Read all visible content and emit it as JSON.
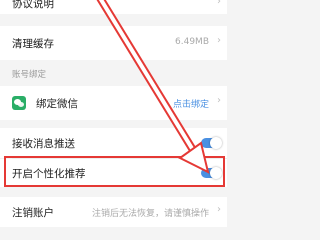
{
  "settings": {
    "agreement_label": "协议说明",
    "clear_cache_label": "清理缓存",
    "cache_size": "6.49MB",
    "account_binding_header": "账号绑定",
    "bind_wechat_label": "绑定微信",
    "bind_wechat_action": "点击绑定",
    "receive_push_label": "接收消息推送",
    "receive_push_enabled": true,
    "personalized_recommend_label": "开启个性化推荐",
    "personalized_recommend_enabled": true,
    "cancel_account_label": "注销账户",
    "cancel_account_note": "注销后无法恢复，请谨慎操作"
  },
  "icons": {
    "chevron": "chevron-right-icon",
    "wechat": "wechat-icon"
  },
  "colors": {
    "accent_blue": "#4a90e2",
    "link_blue": "#4a90e2",
    "wechat_green": "#2aae67",
    "annotation_red": "#e53935"
  }
}
